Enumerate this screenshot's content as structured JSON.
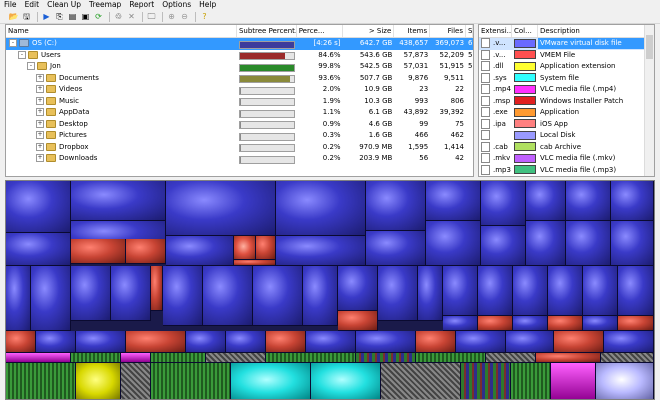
{
  "menu": [
    "File",
    "Edit",
    "Clean Up",
    "Treemap",
    "Report",
    "Options",
    "Help"
  ],
  "toolbar_icons": [
    "open-icon",
    "save-icon",
    "sep",
    "run-icon",
    "copy-icon",
    "explorer-icon",
    "cmd-icon",
    "refresh-icon",
    "sep",
    "delete-bin-icon",
    "delete-icon",
    "sep",
    "new-folder-icon",
    "sep",
    "zoom-in-icon",
    "zoom-out-icon",
    "sep",
    "help-icon"
  ],
  "tree": {
    "headers": [
      "Name",
      "Subtree Percent...",
      "Perce...",
      "> Size",
      "Items",
      "Files",
      "Su"
    ],
    "rows": [
      {
        "name": "OS (C:)",
        "subtree": "[4:26 s]",
        "percent": "",
        "size": "642.7 GB",
        "items": "438,657",
        "files": "369,073",
        "su": "6",
        "depth": 0,
        "exp": "-",
        "bar_fraction": 1.0,
        "bar_color": "#3c3c9c",
        "selected": true
      },
      {
        "name": "Users",
        "subtree": "",
        "percent": "84.6%",
        "size": "543.6 GB",
        "items": "57,873",
        "files": "52,209",
        "su": "5",
        "depth": 1,
        "exp": "-",
        "bar_fraction": 0.846,
        "bar_color": "#9a2a2a"
      },
      {
        "name": "Jon",
        "subtree": "",
        "percent": "99.8%",
        "size": "542.5 GB",
        "items": "57,031",
        "files": "51,915",
        "su": "5",
        "depth": 2,
        "exp": "-",
        "bar_fraction": 0.998,
        "bar_color": "#2a8a2a"
      },
      {
        "name": "Documents",
        "subtree": "",
        "percent": "93.6%",
        "size": "507.7 GB",
        "items": "9,876",
        "files": "9,511",
        "su": "",
        "depth": 3,
        "exp": "+",
        "bar_fraction": 0.936,
        "bar_color": "#8a8a3a"
      },
      {
        "name": "Videos",
        "subtree": "",
        "percent": "2.0%",
        "size": "10.9 GB",
        "items": "23",
        "files": "22",
        "su": "",
        "depth": 3,
        "exp": "+",
        "bar_fraction": 0.02,
        "bar_color": "#8a8a8a"
      },
      {
        "name": "Music",
        "subtree": "",
        "percent": "1.9%",
        "size": "10.3 GB",
        "items": "993",
        "files": "806",
        "su": "",
        "depth": 3,
        "exp": "+",
        "bar_fraction": 0.019,
        "bar_color": "#8a8a8a"
      },
      {
        "name": "AppData",
        "subtree": "",
        "percent": "1.1%",
        "size": "6.1 GB",
        "items": "43,892",
        "files": "39,392",
        "su": "",
        "depth": 3,
        "exp": "+",
        "bar_fraction": 0.011,
        "bar_color": "#8a8a8a"
      },
      {
        "name": "Desktop",
        "subtree": "",
        "percent": "0.9%",
        "size": "4.6 GB",
        "items": "99",
        "files": "75",
        "su": "",
        "depth": 3,
        "exp": "+",
        "bar_fraction": 0.009,
        "bar_color": "#8a8a8a"
      },
      {
        "name": "Pictures",
        "subtree": "",
        "percent": "0.3%",
        "size": "1.6 GB",
        "items": "466",
        "files": "462",
        "su": "",
        "depth": 3,
        "exp": "+",
        "bar_fraction": 0.003,
        "bar_color": "#8a8a8a"
      },
      {
        "name": "Dropbox",
        "subtree": "",
        "percent": "0.2%",
        "size": "970.9 MB",
        "items": "1,595",
        "files": "1,414",
        "su": "",
        "depth": 3,
        "exp": "+",
        "bar_fraction": 0.002,
        "bar_color": "#8a8a8a"
      },
      {
        "name": "Downloads",
        "subtree": "",
        "percent": "0.2%",
        "size": "203.9 MB",
        "items": "56",
        "files": "42",
        "su": "",
        "depth": 3,
        "exp": "+",
        "bar_fraction": 0.002,
        "bar_color": "#8a8a8a"
      }
    ]
  },
  "ext": {
    "headers": [
      "Extensi...",
      "Col...",
      "Description"
    ],
    "rows": [
      {
        "ext": ".v...",
        "color": "#6a6aff",
        "desc": "VMware virtual disk file",
        "sel": true,
        "n": "4"
      },
      {
        "ext": ".v...",
        "color": "#ff5050",
        "desc": "VMEM File"
      },
      {
        "ext": ".dll",
        "color": "#ffff30",
        "desc": "Application extension"
      },
      {
        "ext": ".sys",
        "color": "#30ffff",
        "desc": "System file"
      },
      {
        "ext": ".mp4",
        "color": "#ff30ff",
        "desc": "VLC media file (.mp4)"
      },
      {
        "ext": ".msp",
        "color": "#e02020",
        "desc": "Windows Installer Patch"
      },
      {
        "ext": ".exe",
        "color": "#ff9a30",
        "desc": "Application"
      },
      {
        "ext": ".ipa",
        "color": "#ff8080",
        "desc": "iOS App"
      },
      {
        "ext": "",
        "color": "#9a9aff",
        "desc": "Local Disk"
      },
      {
        "ext": ".cab",
        "color": "#b0e060",
        "desc": "cab Archive"
      },
      {
        "ext": ".mkv",
        "color": "#c060ff",
        "desc": "VLC media file (.mkv)"
      },
      {
        "ext": ".mp3",
        "color": "#40c080",
        "desc": "VLC media file (.mp3)"
      }
    ]
  },
  "colors": {
    "selection": "#3399ff",
    "treemap_bg": "#1a1a4a"
  }
}
